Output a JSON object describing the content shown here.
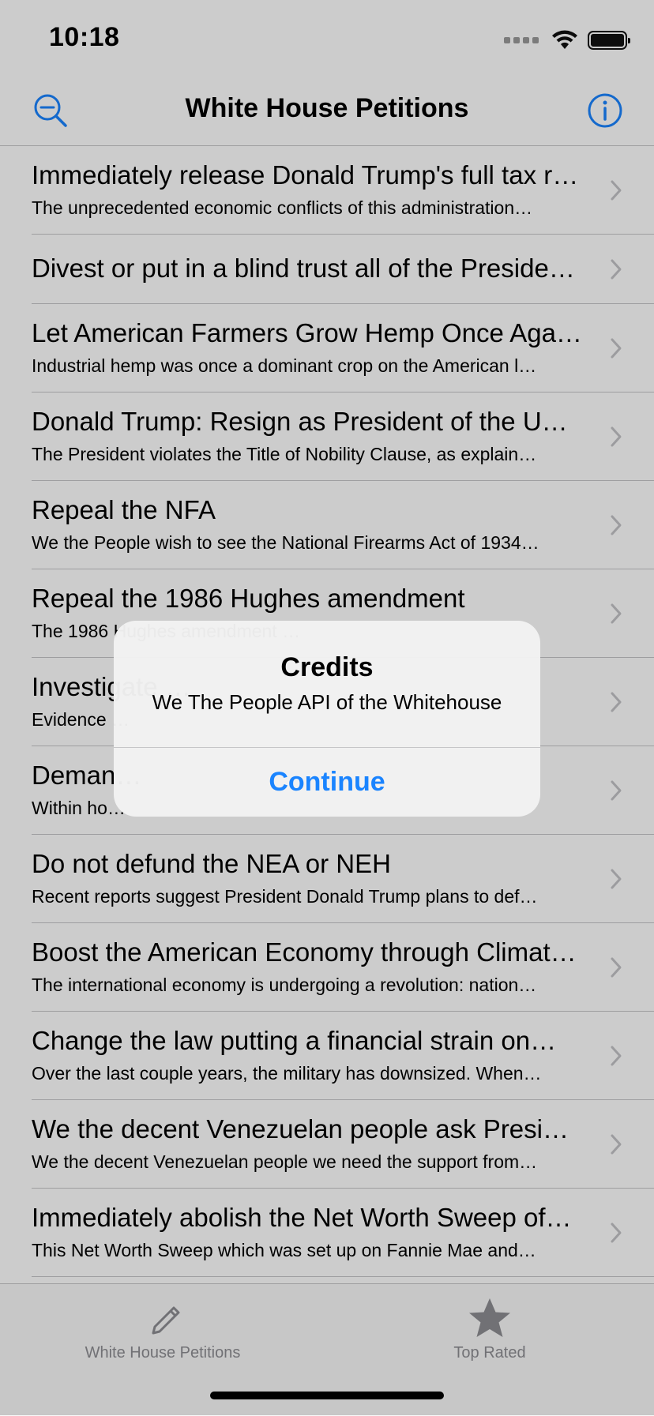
{
  "status_bar": {
    "time": "10:18"
  },
  "nav": {
    "title": "White House Petitions",
    "left_icon": "search-zoom-out-icon",
    "right_icon": "info-icon"
  },
  "petitions": [
    {
      "title": "Immediately release Donald Trump's full tax r…",
      "subtitle": "The unprecedented economic conflicts of this administration…"
    },
    {
      "title": "Divest or put in a blind trust all of the Preside…",
      "subtitle": ""
    },
    {
      "title": "Let American Farmers Grow Hemp Once Aga…",
      "subtitle": "Industrial hemp was once a dominant crop on the American l…"
    },
    {
      "title": "Donald Trump:  Resign as President of the U…",
      "subtitle": "The President violates the Title of Nobility Clause, as explain…"
    },
    {
      "title": "Repeal the NFA",
      "subtitle": "We the People wish to see the National Firearms Act of 1934…"
    },
    {
      "title": "Repeal the 1986 Hughes amendment",
      "subtitle": "The 1986 Hughes amendment …"
    },
    {
      "title": "Investigate …",
      "subtitle": "Evidence …"
    },
    {
      "title": "Deman…",
      "subtitle": "Within ho…"
    },
    {
      "title": "Do not defund the NEA or NEH",
      "subtitle": "Recent reports suggest President Donald Trump plans to def…"
    },
    {
      "title": "Boost the American Economy through Climat…",
      "subtitle": "The international economy is undergoing a revolution: nation…"
    },
    {
      "title": "Change the law putting a financial strain on…",
      "subtitle": "Over the last couple years, the military has downsized. When…"
    },
    {
      "title": "We the decent Venezuelan people ask Presi…",
      "subtitle": "We the decent Venezuelan people we need the support from…"
    },
    {
      "title": "Immediately abolish the Net Worth Sweep of…",
      "subtitle": "This Net Worth Sweep which was set up on Fannie Mae and…"
    }
  ],
  "alert": {
    "title": "Credits",
    "message": "We The People API of the Whitehouse",
    "button": "Continue"
  },
  "tab_bar": {
    "tabs": [
      {
        "label": "White House Petitions",
        "icon": "pencil-icon"
      },
      {
        "label": "Top Rated",
        "icon": "star-icon"
      }
    ]
  },
  "colors": {
    "accent": "#1a84ff",
    "tab_inactive": "#8e8e93",
    "separator": "#c6c6c8"
  }
}
